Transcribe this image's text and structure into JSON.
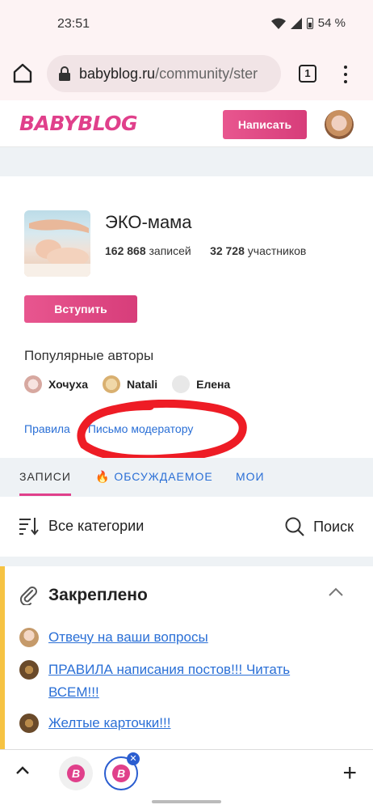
{
  "status_bar": {
    "time": "23:51",
    "battery": "54 %"
  },
  "browser": {
    "url_host": "babyblog.ru",
    "url_path": "/community/ster",
    "tab_count": "1"
  },
  "site_header": {
    "logo": "BABYBLOG",
    "write_button": "Написать"
  },
  "community": {
    "title": "ЭКО-мама",
    "posts_count": "162 868",
    "posts_label": "записей",
    "members_count": "32 728",
    "members_label": "участников",
    "join_button": "Вступить",
    "popular_authors_title": "Популярные авторы",
    "authors": [
      {
        "name": "Хочуха"
      },
      {
        "name": "Natali"
      },
      {
        "name": "Елена"
      }
    ],
    "links": {
      "rules": "Правила",
      "moderator_letter": "Письмо модератору"
    }
  },
  "tabs": {
    "posts": "ЗАПИСИ",
    "discussed_icon": "🔥",
    "discussed": "ОБСУЖДАЕМОЕ",
    "mine": "МОИ"
  },
  "filter": {
    "categories": "Все категории",
    "search": "Поиск"
  },
  "pinned": {
    "title": "Закреплено",
    "items": [
      {
        "line1": "Отвечу на ваши вопросы",
        "line2": ""
      },
      {
        "line1": "ПРАВИЛА написания постов!!! Читать",
        "line2": "ВСЕМ!!!"
      },
      {
        "line1": "Желтые карточки!!!",
        "line2": ""
      }
    ]
  },
  "bottom_bar": {
    "new_tab": "+"
  },
  "colors": {
    "brand_pink": "#e0408b",
    "link_blue": "#2a6fd6",
    "pinned_accent": "#f6c343"
  }
}
